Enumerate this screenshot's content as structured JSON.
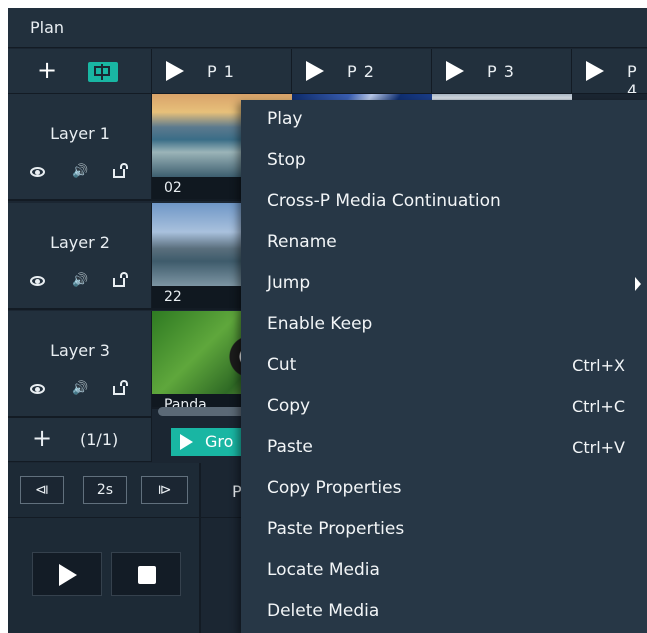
{
  "title": "Plan",
  "tabs": [
    "P 1",
    "P 2",
    "P 3",
    "P 4"
  ],
  "layers": [
    {
      "name": "Layer 1",
      "thumb_caption": "02"
    },
    {
      "name": "Layer 2",
      "thumb_caption": "22"
    },
    {
      "name": "Layer 3",
      "thumb_caption": "Panda"
    }
  ],
  "icons": {
    "speaker": "🔊"
  },
  "page_nav": {
    "add": "+",
    "count": "(1/1)"
  },
  "group_button": "Gro",
  "playback": {
    "prev": "⧏",
    "interval": "2s",
    "next": "⧐",
    "pi_label": "P"
  },
  "colors": {
    "accent": "#19b6a3",
    "background": "#1b2632",
    "menu": "#273746"
  },
  "context_menu": [
    {
      "label": "Play",
      "shortcut": ""
    },
    {
      "label": "Stop",
      "shortcut": ""
    },
    {
      "label": "Cross-P Media Continuation",
      "shortcut": ""
    },
    {
      "label": "Rename",
      "shortcut": ""
    },
    {
      "label": "Jump",
      "shortcut": "",
      "submenu": true
    },
    {
      "label": "Enable Keep",
      "shortcut": ""
    },
    {
      "label": "Cut",
      "shortcut": "Ctrl+X"
    },
    {
      "label": "Copy",
      "shortcut": "Ctrl+C"
    },
    {
      "label": "Paste",
      "shortcut": "Ctrl+V"
    },
    {
      "label": "Copy Properties",
      "shortcut": ""
    },
    {
      "label": "Paste Properties",
      "shortcut": ""
    },
    {
      "label": "Locate Media",
      "shortcut": ""
    },
    {
      "label": "Delete Media",
      "shortcut": ""
    }
  ]
}
